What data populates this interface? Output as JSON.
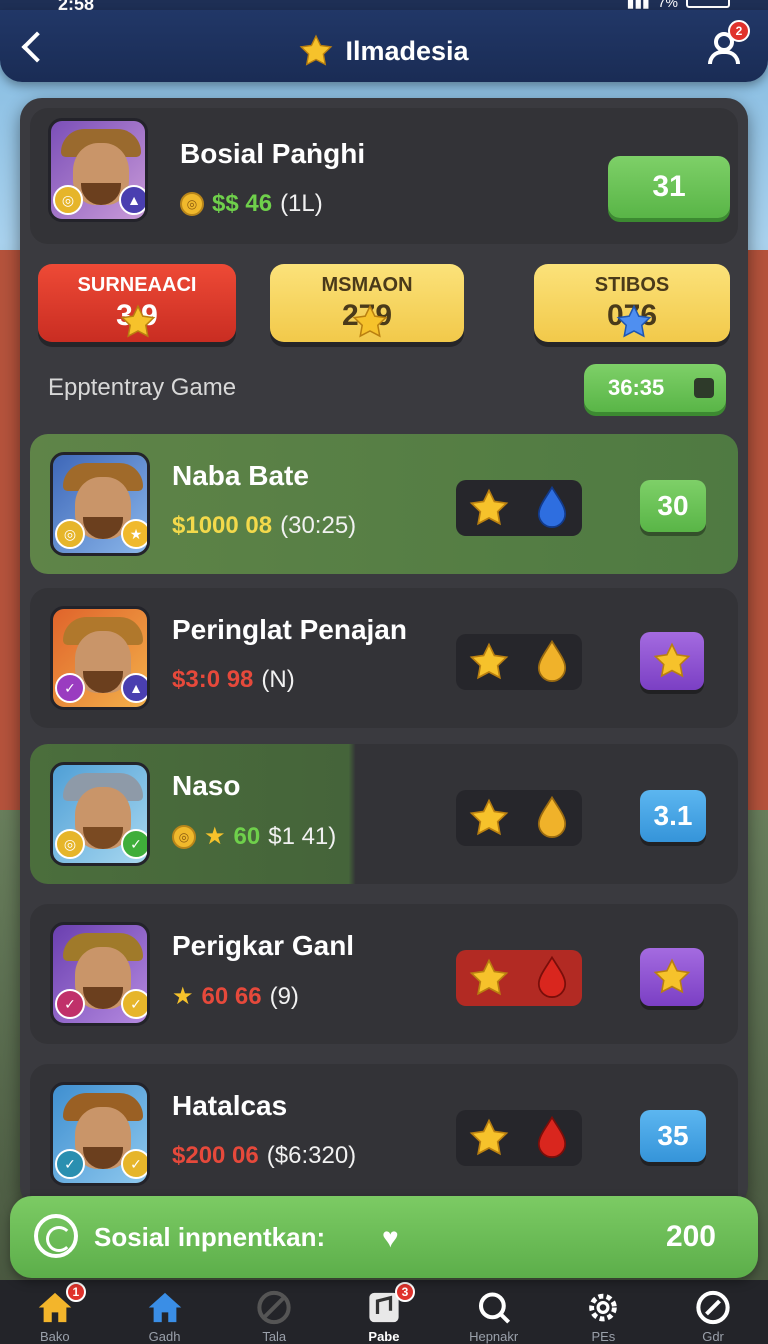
{
  "status_bar": {
    "time": "2:58",
    "battery": "7%"
  },
  "header": {
    "title": "Ilmadesia",
    "notification_count": "2"
  },
  "user": {
    "name": "Bosial Paṅghi",
    "money": "$$ 46",
    "extra": "(1L)",
    "score": "31"
  },
  "stats": [
    {
      "label": "SURNEAACI",
      "value": "3 9",
      "color": "#e6392b"
    },
    {
      "label": "MSMAON",
      "value": "279",
      "color": "#f2c94a"
    },
    {
      "label": "STIBOS",
      "value": "076",
      "color": "#f2c94a"
    }
  ],
  "event": {
    "label": "Epptentray Game",
    "timer": "36:35"
  },
  "rows": [
    {
      "name": "Naba Bate",
      "amount": "$1000 08",
      "detail": "(30:25)",
      "amount_color": "yellow",
      "reward_gem": "blue",
      "action": "30",
      "action_type": "green"
    },
    {
      "name": "Peringlat Penajan",
      "amount": "$3:0 98",
      "detail": "(N)",
      "amount_color": "red",
      "reward_gem": "gold",
      "action": "",
      "action_type": "purple"
    },
    {
      "name": "Naso",
      "amount": "60",
      "detail": "$1 41)",
      "amount_color": "green",
      "reward_gem": "gold",
      "action": "3.1",
      "action_type": "blue"
    },
    {
      "name": "Perigkar Ganl",
      "amount": "60 66",
      "detail": "(9)",
      "amount_color": "red",
      "reward_gem": "red",
      "action": "",
      "action_type": "purple"
    },
    {
      "name": "Hatalcas",
      "amount": "$200 06",
      "detail": "($6:320)",
      "amount_color": "red",
      "reward_gem": "red",
      "action": "35",
      "action_type": "blue"
    }
  ],
  "banner": {
    "text": "Sosial inpnentkan:",
    "value": "200"
  },
  "nav": {
    "items": [
      {
        "label": "Bako",
        "badge": "1"
      },
      {
        "label": "Gadh",
        "badge": ""
      },
      {
        "label": "Tala",
        "badge": ""
      },
      {
        "label": "Pabe",
        "badge": "3"
      },
      {
        "label": "Hepnakr",
        "badge": ""
      },
      {
        "label": "PEs",
        "badge": ""
      },
      {
        "label": "Gdr",
        "badge": ""
      }
    ]
  },
  "colors": {
    "accent_green": "#5cae4a",
    "header_navy": "#1a2c55",
    "panel": "#3a3a3f"
  }
}
